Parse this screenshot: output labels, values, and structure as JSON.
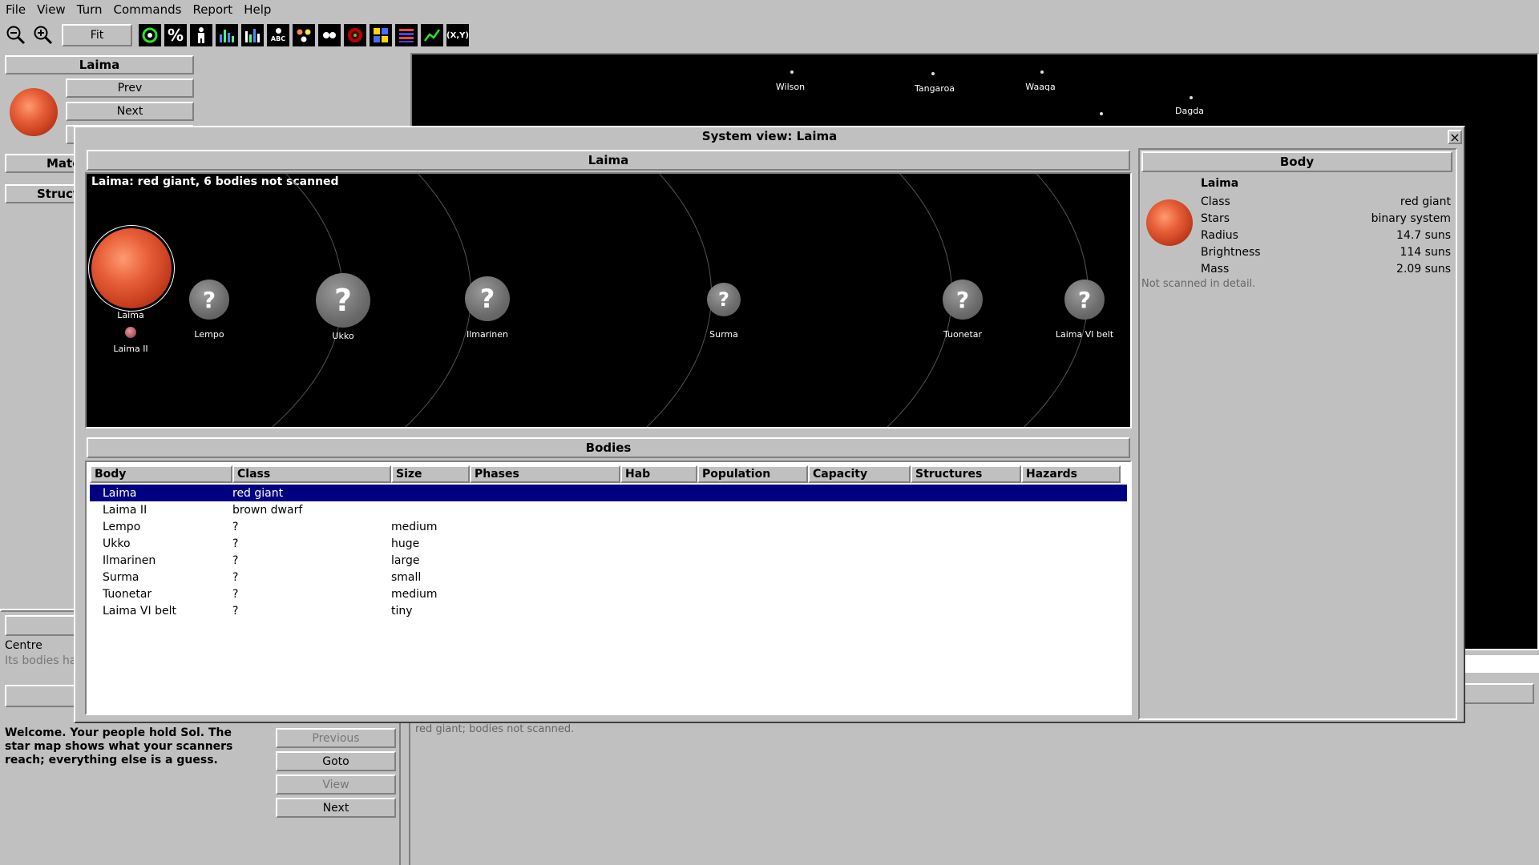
{
  "menu": [
    "File",
    "View",
    "Turn",
    "Commands",
    "Report",
    "Help"
  ],
  "toolbar": {
    "fit_label": "Fit",
    "coord_label": "(X,Y)",
    "abc_label": "ABC",
    "percent_label": "%"
  },
  "left_panel": {
    "title": "Laima",
    "prev": "Prev",
    "next": "Next",
    "tab1": "Mate",
    "tab2": "Struct",
    "centre_label": "Centre",
    "bodies_note": "Its bodies hav"
  },
  "messages": {
    "text": "Welcome. Your people hold Sol. The star map shows what your scanners reach; everything else is a guess.",
    "previous": "Previous",
    "goto": "Goto",
    "view": "View",
    "next": "Next",
    "status": "red giant; bodies not scanned."
  },
  "starmap": {
    "stars": [
      {
        "name": "Wilson"
      },
      {
        "name": "Tangaroa"
      },
      {
        "name": "Waaqa"
      },
      {
        "name": "Dagda"
      }
    ]
  },
  "dialog": {
    "title": "System view: Laima",
    "close": "×",
    "system_header": "Laima",
    "system_caption": "Laima: red giant, 6 bodies not scanned",
    "star_label": "Laima",
    "companion_label": "Laima II",
    "unknown_glyph": "?",
    "bodies": [
      {
        "name": "Lempo"
      },
      {
        "name": "Ukko"
      },
      {
        "name": "Ilmarinen"
      },
      {
        "name": "Surma"
      },
      {
        "name": "Tuonetar"
      },
      {
        "name": "Laima VI belt"
      }
    ],
    "bodies_header": "Bodies",
    "columns": [
      "Body",
      "Class",
      "Size",
      "Phases",
      "Hab",
      "Population",
      "Capacity",
      "Structures",
      "Hazards"
    ],
    "rows": [
      [
        "Laima",
        "red giant",
        ""
      ],
      [
        "Laima II",
        "brown dwarf",
        ""
      ],
      [
        "Lempo",
        "?",
        "medium"
      ],
      [
        "Ukko",
        "?",
        "huge"
      ],
      [
        "Ilmarinen",
        "?",
        "large"
      ],
      [
        "Surma",
        "?",
        "small"
      ],
      [
        "Tuonetar",
        "?",
        "medium"
      ],
      [
        "Laima VI belt",
        "?",
        "tiny"
      ]
    ],
    "body_panel": {
      "header": "Body",
      "name": "Laima",
      "props": [
        {
          "k": "Class",
          "v": "red giant"
        },
        {
          "k": "Stars",
          "v": "binary system"
        },
        {
          "k": "Radius",
          "v": "14.7 suns"
        },
        {
          "k": "Brightness",
          "v": "114 suns"
        },
        {
          "k": "Mass",
          "v": "2.09 suns"
        }
      ],
      "note": "Not scanned in detail."
    }
  },
  "colors": {
    "selection": "#000080",
    "map_bg": "#000000",
    "window_bg": "#c0c0c0"
  }
}
